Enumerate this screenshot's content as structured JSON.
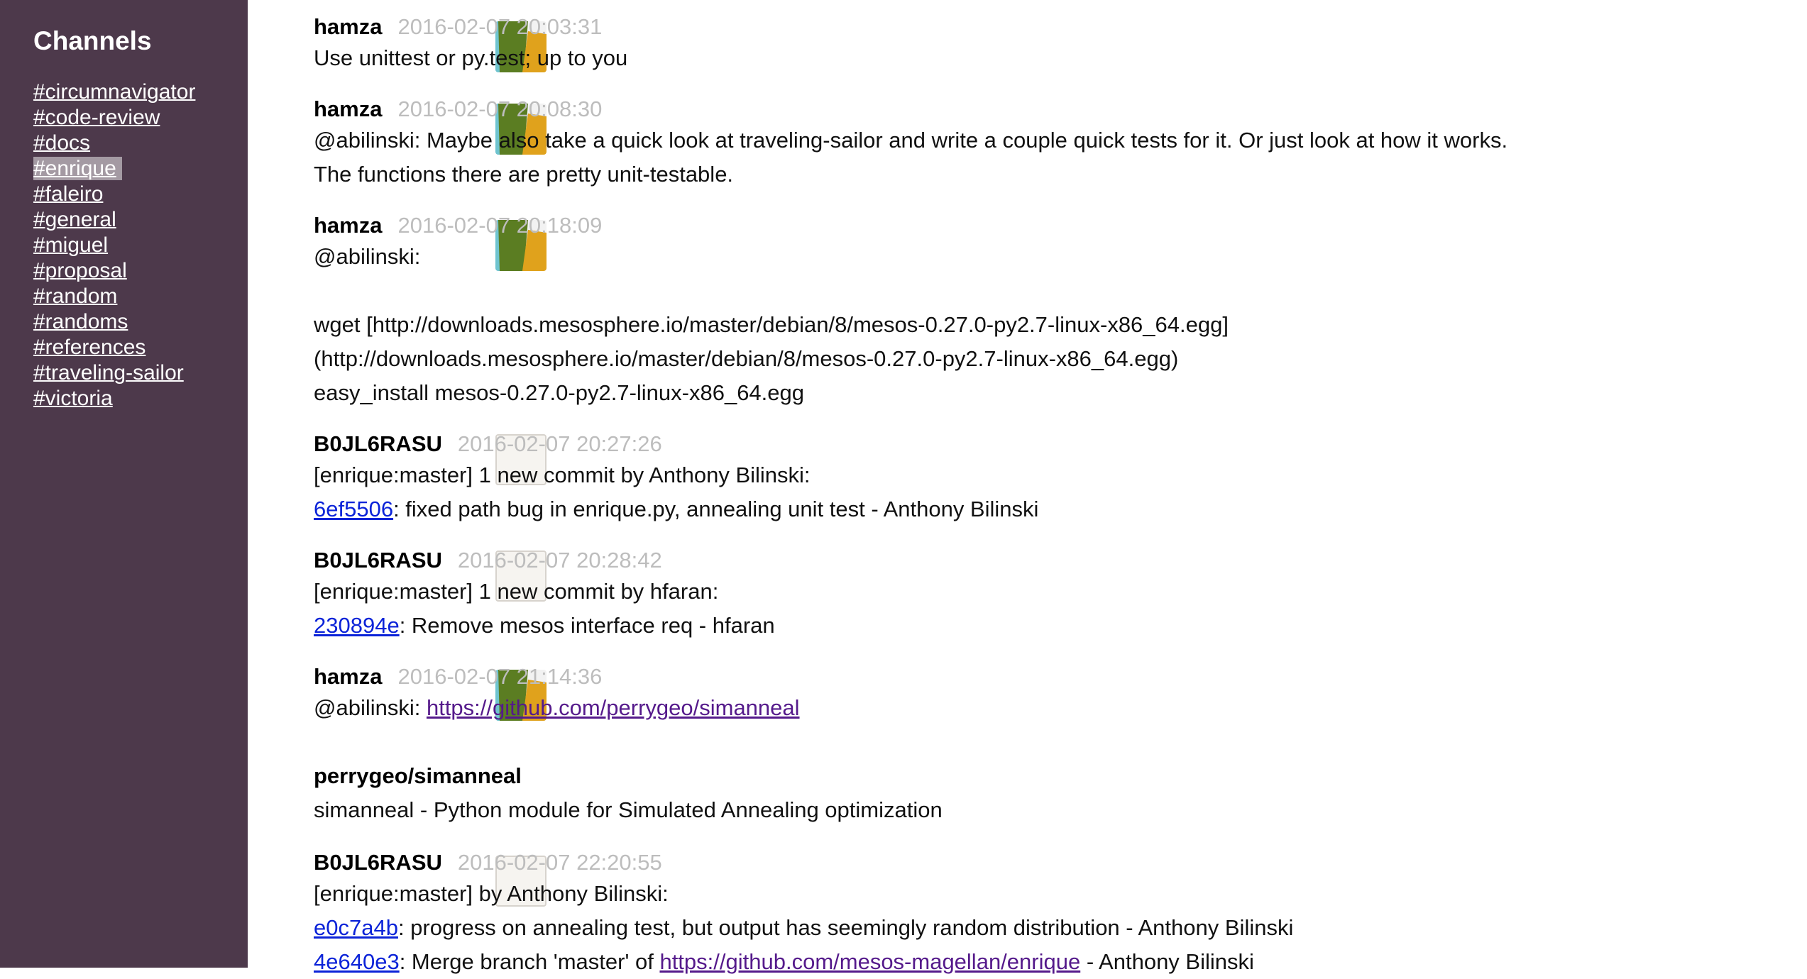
{
  "sidebar": {
    "title": "Channels",
    "channels": [
      {
        "label": "#circumnavigator"
      },
      {
        "label": "#code-review"
      },
      {
        "label": "#docs"
      },
      {
        "label": "#enrique",
        "selected": true
      },
      {
        "label": "#faleiro"
      },
      {
        "label": "#general"
      },
      {
        "label": "#miguel"
      },
      {
        "label": "#proposal"
      },
      {
        "label": "#random"
      },
      {
        "label": "#randoms"
      },
      {
        "label": "#references"
      },
      {
        "label": "#traveling-sailor"
      },
      {
        "label": "#victoria"
      }
    ]
  },
  "colors": {
    "sidebar_bg": "#4d394b",
    "selected_bg": "#a49aa3",
    "timestamp": "#bdbdbd",
    "link": "#0b23d8",
    "visited_link": "#551a8b",
    "avatar_green": "#5b7d22",
    "avatar_orange": "#e0a21c",
    "avatar_teal": "#6fc4cf"
  },
  "messages": [
    {
      "author": "hamza",
      "time": "2016-02-07 20:03:31",
      "avatar": "hamza-avatar",
      "lines": [
        "Use unittest or py.test; up to you"
      ]
    },
    {
      "author": "hamza",
      "time": "2016-02-07 20:08:30",
      "avatar": "hamza-avatar",
      "lines": [
        "@abilinski: Maybe also take a quick look at traveling-sailor and write a couple quick tests for it. Or just look at how it works. The functions there are pretty unit-testable."
      ]
    },
    {
      "author": "hamza",
      "time": "2016-02-07 20:18:09",
      "avatar": "hamza-avatar",
      "lines": [
        "@abilinski:",
        "wget [http://downloads.mesosphere.io/master/debian/8/mesos-0.27.0-py2.7-linux-x86_64.egg]",
        "(http://downloads.mesosphere.io/master/debian/8/mesos-0.27.0-py2.7-linux-x86_64.egg)",
        "easy_install mesos-0.27.0-py2.7-linux-x86_64.egg"
      ]
    },
    {
      "author": "B0JL6RASU",
      "time": "2016-02-07 20:27:26",
      "avatar": "bot-avatar",
      "lines": [
        "[enrique:master] 1 new commit by Anthony Bilinski:"
      ],
      "commits": [
        {
          "hash": "6ef5506",
          "text": ": fixed path bug in enrique.py, annealing unit test - Anthony Bilinski"
        }
      ]
    },
    {
      "author": "B0JL6RASU",
      "time": "2016-02-07 20:28:42",
      "avatar": "bot-avatar",
      "lines": [
        "[enrique:master] 1 new commit by hfaran:"
      ],
      "commits": [
        {
          "hash": "230894e",
          "text": ": Remove mesos interface req - hfaran"
        }
      ]
    },
    {
      "author": "hamza",
      "time": "2016-02-07 21:14:36",
      "avatar": "hamza-avatar",
      "prefix": "@abilinski: ",
      "url": "https://github.com/perrygeo/simanneal",
      "attachment": {
        "title": "perrygeo/simanneal",
        "text": "simanneal - Python module for Simulated Annealing optimization"
      }
    },
    {
      "author": "B0JL6RASU",
      "time": "2016-02-07 22:20:55",
      "avatar": "bot-avatar",
      "lines": [
        "[enrique:master] by Anthony Bilinski:"
      ],
      "commits": [
        {
          "hash": "e0c7a4b",
          "text": ": progress on annealing test, but output has seemingly random distribution - Anthony Bilinski"
        },
        {
          "hash": "4e640e3",
          "text": ": Merge branch 'master' of ",
          "url": "https://github.com/mesos-magellan/enrique",
          "suffix": " - Anthony Bilinski"
        }
      ]
    }
  ]
}
